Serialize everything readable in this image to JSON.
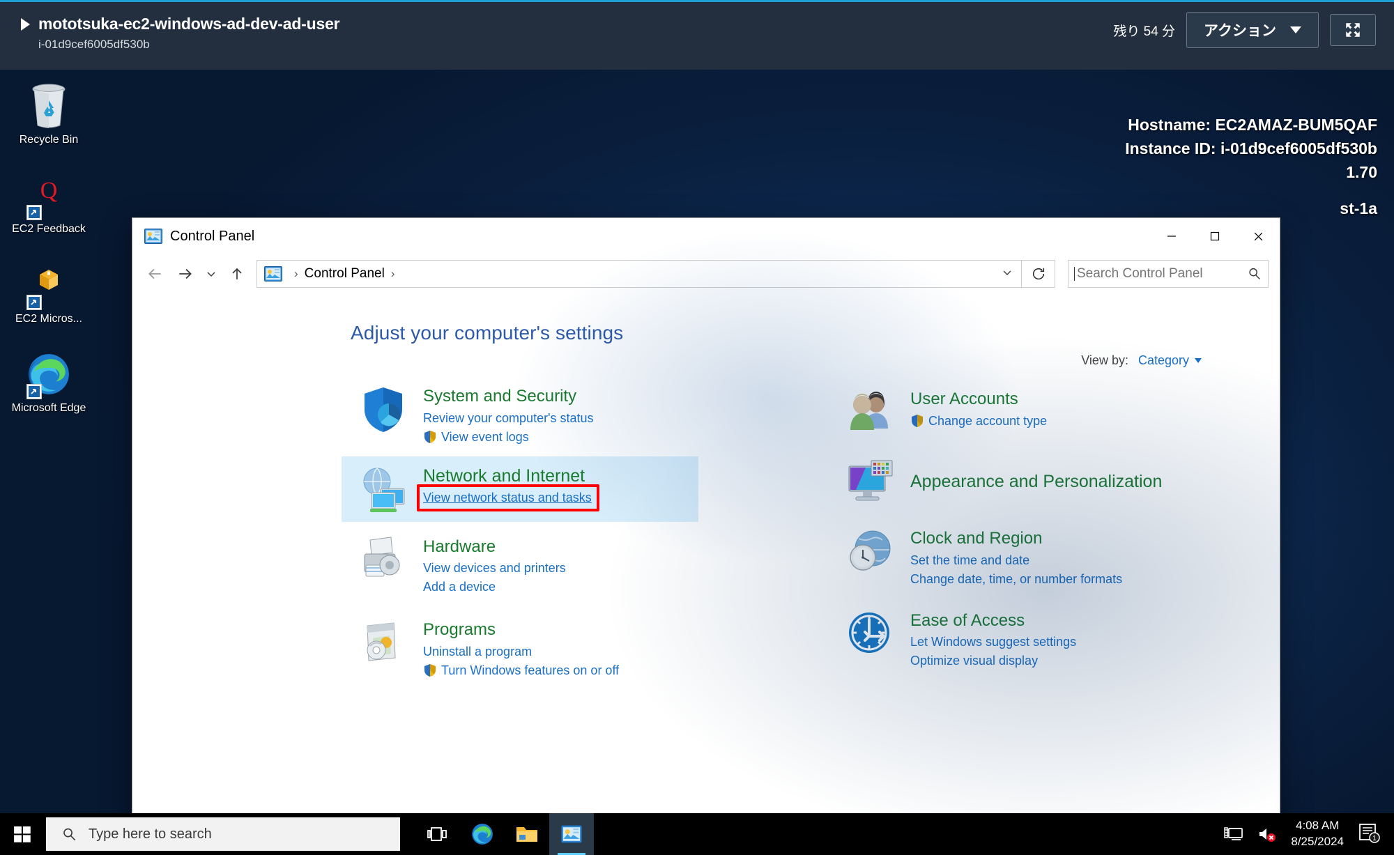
{
  "banner": {
    "instance_name": "mototsuka-ec2-windows-ad-dev-ad-user",
    "instance_id": "i-01d9cef6005df530b",
    "time_remaining": "残り 54 分",
    "action_label": "アクション",
    "fullscreen_icon": "fullscreen-icon",
    "expand_icon": "play-triangle-icon",
    "accent_color": "#1f9ed4",
    "bar_color": "#232f3e"
  },
  "desktop": {
    "icons": [
      {
        "label": "Recycle Bin",
        "icon": "recycle-bin-icon",
        "shortcut": false
      },
      {
        "label": "EC2 Feedback",
        "icon": "ec2-feedback-icon",
        "shortcut": true
      },
      {
        "label": "EC2 Micros...",
        "icon": "ec2-microsoft-icon",
        "shortcut": true
      },
      {
        "label": "Microsoft Edge",
        "icon": "microsoft-edge-icon",
        "shortcut": true
      }
    ],
    "host_info": [
      "Hostname: EC2AMAZ-BUM5QAF",
      "Instance ID: i-01d9cef6005df530b",
      "1.70",
      "st-1a"
    ]
  },
  "control_panel": {
    "title": "Control Panel",
    "title_icon": "control-panel-icon",
    "window_buttons": {
      "minimize": "minimize-icon",
      "maximize": "maximize-icon",
      "close": "close-icon"
    },
    "nav": {
      "back_icon": "arrow-left-icon",
      "forward_icon": "arrow-right-icon",
      "recent_icon": "chevron-down-icon",
      "up_icon": "arrow-up-icon",
      "breadcrumb_icon": "control-panel-icon",
      "breadcrumb": "Control Panel",
      "separator": "›",
      "dropdown_icon": "chevron-down-icon",
      "refresh_icon": "refresh-icon"
    },
    "search": {
      "placeholder": "Search Control Panel",
      "icon": "search-icon"
    },
    "heading": "Adjust your computer's settings",
    "view_by": {
      "label": "View by:",
      "value": "Category",
      "caret": "chevron-down-icon"
    },
    "categories_left": [
      {
        "title": "System and Security",
        "icon": "shield-system-icon",
        "links": [
          {
            "text": "Review your computer's status",
            "shield": false
          },
          {
            "text": "View event logs",
            "shield": true
          }
        ],
        "highlighted": false
      },
      {
        "title": "Network and Internet",
        "icon": "network-globe-icon",
        "links": [
          {
            "text": "View network status and tasks",
            "shield": false,
            "boxed": true
          }
        ],
        "highlighted": true
      },
      {
        "title": "Hardware",
        "icon": "printer-icon",
        "links": [
          {
            "text": "View devices and printers",
            "shield": false
          },
          {
            "text": "Add a device",
            "shield": false
          }
        ],
        "highlighted": false
      },
      {
        "title": "Programs",
        "icon": "programs-disc-icon",
        "links": [
          {
            "text": "Uninstall a program",
            "shield": false
          },
          {
            "text": "Turn Windows features on or off",
            "shield": true
          }
        ],
        "highlighted": false
      }
    ],
    "categories_right": [
      {
        "title": "User Accounts",
        "icon": "user-accounts-icon",
        "links": [
          {
            "text": "Change account type",
            "shield": true
          }
        ],
        "highlighted": false
      },
      {
        "title": "Appearance and Personalization",
        "icon": "appearance-monitor-icon",
        "links": [],
        "highlighted": false
      },
      {
        "title": "Clock and Region",
        "icon": "clock-globe-icon",
        "links": [
          {
            "text": "Set the time and date",
            "shield": false
          },
          {
            "text": "Change date, time, or number formats",
            "shield": false
          }
        ],
        "highlighted": false
      },
      {
        "title": "Ease of Access",
        "icon": "ease-of-access-icon",
        "links": [
          {
            "text": "Let Windows suggest settings",
            "shield": false
          },
          {
            "text": "Optimize visual display",
            "shield": false
          }
        ],
        "highlighted": false
      }
    ],
    "highlight_color": "#d9eefb",
    "annotation_box_color": "#ff0000"
  },
  "taskbar": {
    "start_icon": "windows-start-icon",
    "search_placeholder": "Type here to search",
    "search_icon": "search-icon",
    "pinned": [
      {
        "icon": "task-view-icon",
        "active": false
      },
      {
        "icon": "microsoft-edge-icon",
        "active": false
      },
      {
        "icon": "file-explorer-icon",
        "active": false
      },
      {
        "icon": "control-panel-icon",
        "active": true
      }
    ],
    "tray": {
      "network_icon": "network-remote-icon",
      "volume_icon": "volume-muted-icon",
      "time": "4:08 AM",
      "date": "8/25/2024",
      "notification_icon": "action-center-icon",
      "notification_count": "1"
    }
  }
}
